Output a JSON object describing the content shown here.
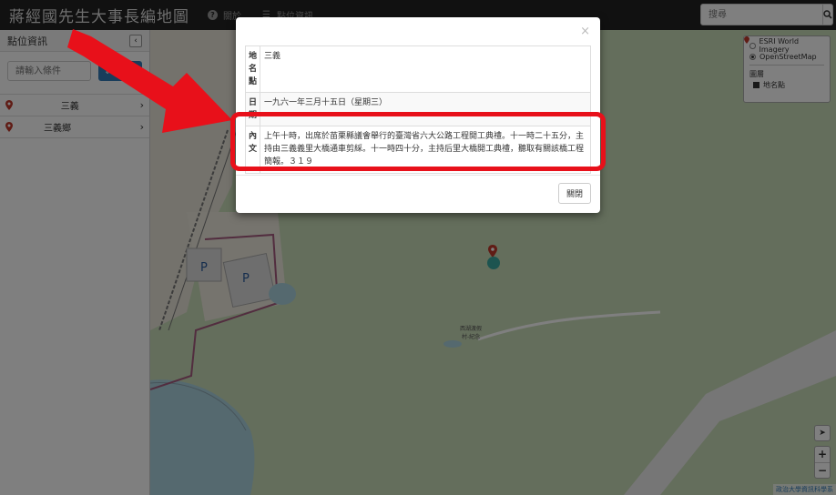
{
  "app": {
    "title": "蔣經國先生大事長編地圖",
    "nav": {
      "about": "關於",
      "points": "點位資訊"
    },
    "search_placeholder": "搜尋"
  },
  "sidebar": {
    "title": "點位資訊",
    "collapse": "‹",
    "filter_placeholder": "請輸入條件",
    "sort_label": "排序",
    "items": [
      {
        "label": "三義"
      },
      {
        "label": "三義鄉"
      }
    ]
  },
  "map": {
    "layers": {
      "base": [
        {
          "label": "ESRI World Imagery",
          "selected": false
        },
        {
          "label": "OpenStreetMap",
          "selected": true
        }
      ],
      "overlay_title": "圖層",
      "overlays": [
        {
          "label": "地名點",
          "checked": true
        }
      ]
    },
    "labels": {
      "parking": "P",
      "place1": "西湖渡假村-紀念館",
      "place2": "西湖渡假大飯店",
      "road": "西湖渡假村"
    },
    "zoom_in": "+",
    "zoom_out": "−",
    "locate": "➤",
    "attribution": "政治大學資訊科學系"
  },
  "modal": {
    "close_x": "×",
    "rows": [
      {
        "key": "地名點",
        "value": "三義"
      },
      {
        "key": "日期",
        "value": "一九六一年三月十五日（星期三）"
      },
      {
        "key": "內文",
        "value": "上午十時，出席於苗栗縣議會舉行的臺灣省六大公路工程開工典禮。十一時二十五分，主持由三義義里大橋通車剪綵。十一時四十分，主持后里大橋開工典禮，聽取有關該橋工程簡報。３１９"
      }
    ],
    "close_button": "關閉"
  },
  "colors": {
    "highlight": "#e8101a",
    "navbar": "#222222",
    "accent": "#337ab7"
  }
}
